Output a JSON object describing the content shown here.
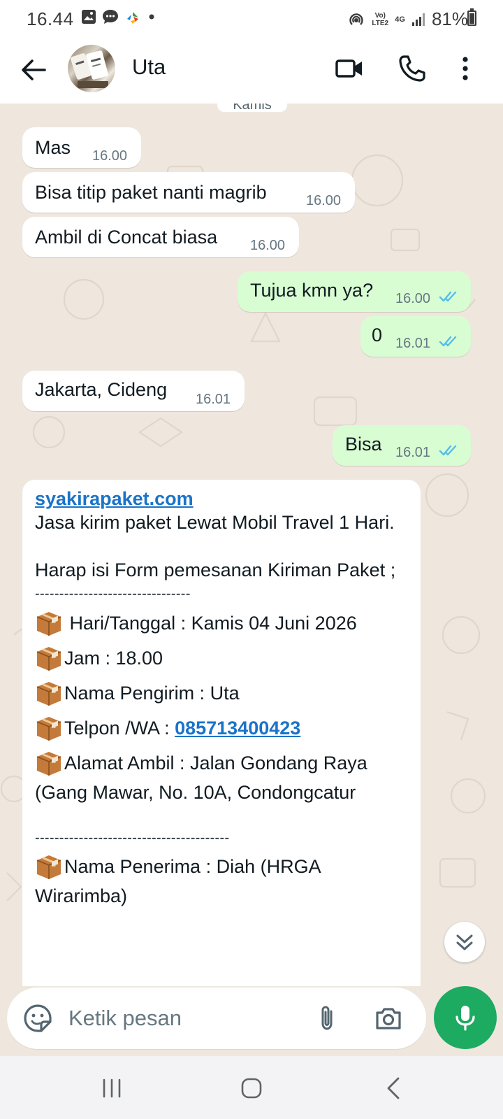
{
  "status_bar": {
    "time": "16.44",
    "network": "Vo) LTE2",
    "signal_label": "4G",
    "battery": "81%",
    "battery_level": 0.81
  },
  "header": {
    "contact_name": "Uta"
  },
  "chat": {
    "date_chip": "Kamis",
    "messages": [
      {
        "text": "Mas",
        "time": "16.00"
      },
      {
        "text": "Bisa titip paket nanti magrib",
        "time": "16.00"
      },
      {
        "text": "Ambil di Concat biasa",
        "time": "16.00"
      },
      {
        "text": "Tujua  kmn ya?",
        "time": "16.00"
      },
      {
        "text": "0",
        "time": "16.01"
      },
      {
        "text": "Jakarta, Cideng",
        "time": "16.01"
      },
      {
        "text": "Bisa",
        "time": "16.01"
      }
    ],
    "form_message": {
      "link": "syakirapaket.com",
      "line1": "Jasa kirim paket Lewat Mobil Travel 1 Hari.",
      "line2": "Harap isi Form pemesanan Kiriman Paket ;",
      "separator1": "--------------------------------",
      "date_field": " Hari/Tanggal : Kamis 04 Juni 2026",
      "time_field": "Jam : 18.00",
      "sender_field": "Nama Pengirim : Uta",
      "phone_label": "Telpon /WA : ",
      "phone_number": "085713400423",
      "address_field": "Alamat Ambil : Jalan Gondang Raya (Gang Mawar, No. 10A, Condongcatur",
      "separator2": "----------------------------------------",
      "receiver_field": "Nama Penerima : Diah (HRGA Wirarimba)"
    }
  },
  "input": {
    "placeholder": "Ketik pesan"
  },
  "colors": {
    "outgoing_bubble": "#d9fdd3",
    "incoming_bubble": "#ffffff",
    "chat_background": "#efe7de",
    "accent_green": "#1daa61",
    "read_tick": "#53bdeb",
    "link": "#1a73c8"
  }
}
